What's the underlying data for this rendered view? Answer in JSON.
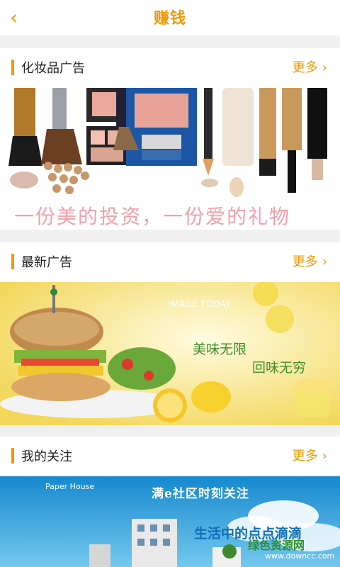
{
  "header": {
    "title": "赚钱",
    "back_icon": "back-arrow-icon"
  },
  "sections": [
    {
      "label": "化妆品广告",
      "more": "更多",
      "banner_text": "一份美的投资，一份爱的礼物"
    },
    {
      "label": "最新广告",
      "more": "更多",
      "banner_heading": "IMAGE TODAY",
      "banner_line1": "美味无限",
      "banner_line2": "回味无穷"
    },
    {
      "label": "我的关注",
      "more": "更多",
      "banner_brand_a": "Paper",
      "banner_brand_b": "House",
      "banner_line1": "满e社区时刻关注",
      "banner_line2": "生活中的点点滴滴"
    }
  ],
  "watermark": {
    "site": "绿色资源网",
    "url": "www.downcc.com"
  },
  "colors": {
    "accent": "#f39800"
  }
}
